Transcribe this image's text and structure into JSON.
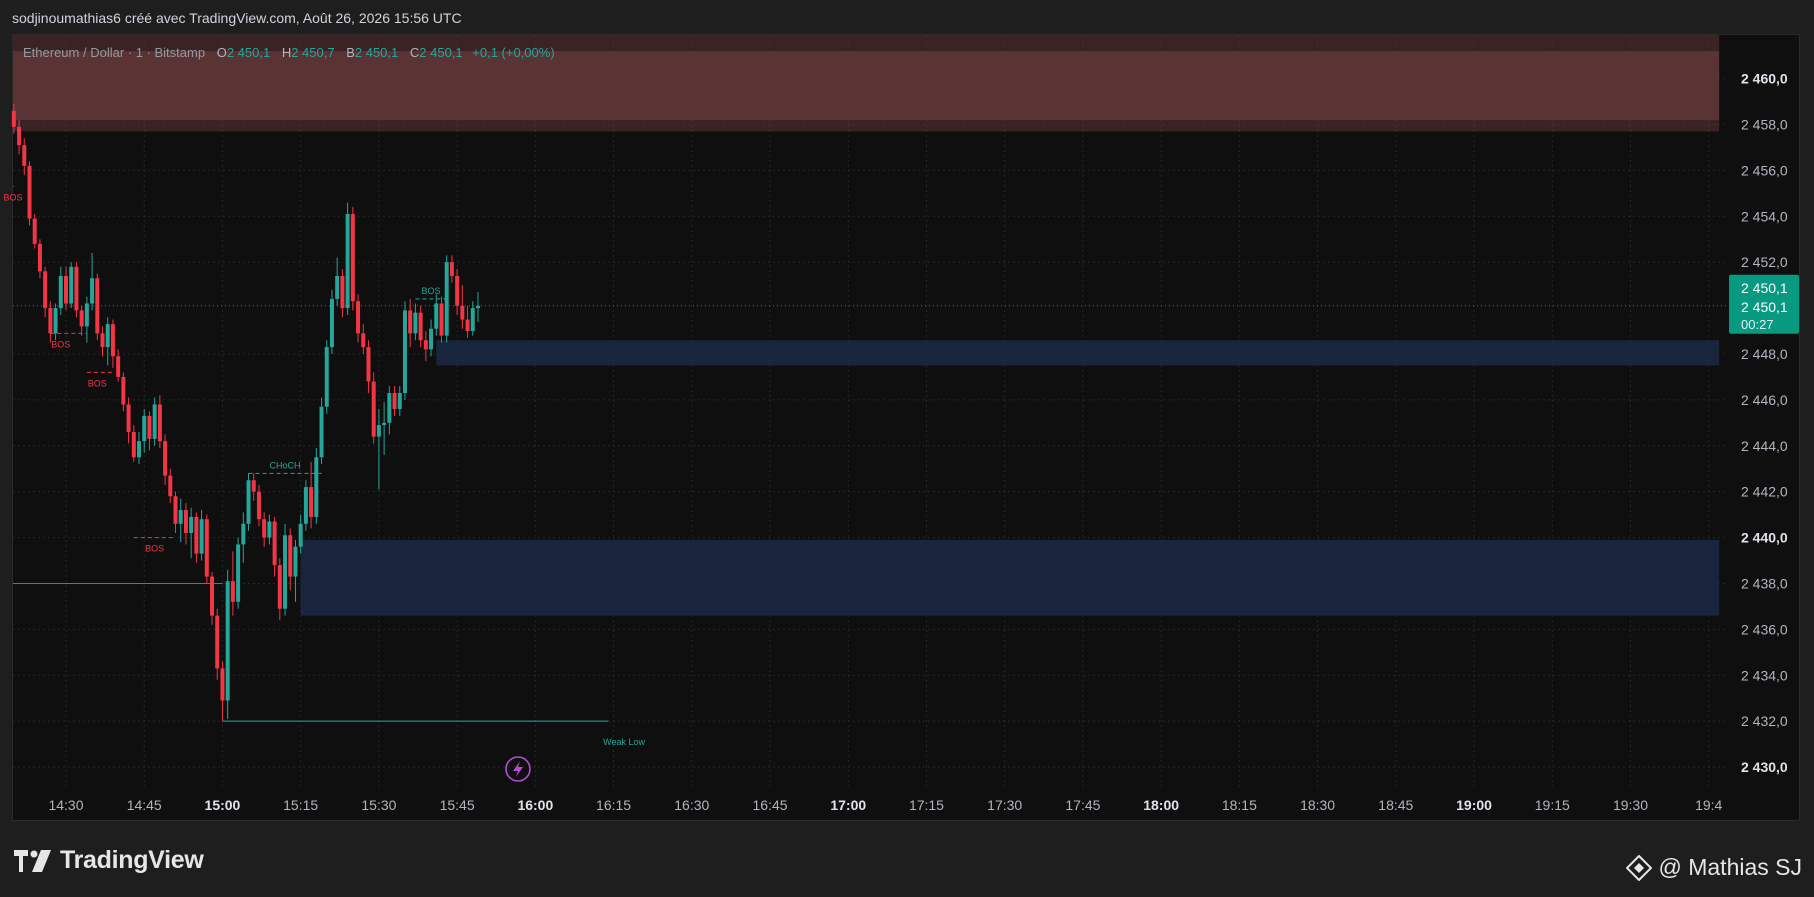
{
  "header": {
    "text": "sodjinoumathias6 créé avec TradingView.com, Août 26, 2026 15:56 UTC"
  },
  "legend": {
    "symbol": "Ethereum / Dollar · 1 · Bitstamp",
    "o_label": "O",
    "o_value": "2 450,1",
    "h_label": "H",
    "h_value": "2 450,7",
    "b_label": "B",
    "b_value": "2 450,1",
    "c_label": "C",
    "c_value": "2 450,1",
    "change": "+0,1 (+0,00%)"
  },
  "price_tag": {
    "price": "2 450,1",
    "price2": "2 450,1",
    "countdown": "00:27",
    "value": 2450.1
  },
  "footer": {
    "brand": "TradingView",
    "credit": "@ Mathias SJ"
  },
  "colors": {
    "up": "#26a69a",
    "down": "#f23645",
    "bg": "#0f0f0f",
    "supply_zone": "#5e3536",
    "demand_zone": "#1a2740",
    "tag": "#089981"
  },
  "chart_data": {
    "type": "candlestick",
    "ylim": [
      2429.0,
      2461.9
    ],
    "y_ticks": [
      {
        "value": 2430.0,
        "label": "2 430,0",
        "bold": true
      },
      {
        "value": 2432.0,
        "label": "2 432,0",
        "bold": false
      },
      {
        "value": 2434.0,
        "label": "2 434,0",
        "bold": false
      },
      {
        "value": 2436.0,
        "label": "2 436,0",
        "bold": false
      },
      {
        "value": 2438.0,
        "label": "2 438,0",
        "bold": false
      },
      {
        "value": 2440.0,
        "label": "2 440,0",
        "bold": true
      },
      {
        "value": 2442.0,
        "label": "2 442,0",
        "bold": false
      },
      {
        "value": 2444.0,
        "label": "2 444,0",
        "bold": false
      },
      {
        "value": 2446.0,
        "label": "2 446,0",
        "bold": false
      },
      {
        "value": 2448.0,
        "label": "2 448,0",
        "bold": false
      },
      {
        "value": 2452.0,
        "label": "2 452,0",
        "bold": false
      },
      {
        "value": 2454.0,
        "label": "2 454,0",
        "bold": false
      },
      {
        "value": 2456.0,
        "label": "2 456,0",
        "bold": false
      },
      {
        "value": 2458.0,
        "label": "2 458,0",
        "bold": false
      },
      {
        "value": 2460.0,
        "label": "2 460,0",
        "bold": true
      }
    ],
    "x_ticks": [
      {
        "label": "14:30",
        "t": 0,
        "bold": false
      },
      {
        "label": "14:45",
        "t": 15,
        "bold": false
      },
      {
        "label": "15:00",
        "t": 30,
        "bold": true
      },
      {
        "label": "15:15",
        "t": 45,
        "bold": false
      },
      {
        "label": "15:30",
        "t": 60,
        "bold": false
      },
      {
        "label": "15:45",
        "t": 75,
        "bold": false
      },
      {
        "label": "16:00",
        "t": 90,
        "bold": true
      },
      {
        "label": "16:15",
        "t": 105,
        "bold": false
      },
      {
        "label": "16:30",
        "t": 120,
        "bold": false
      },
      {
        "label": "16:45",
        "t": 135,
        "bold": false
      },
      {
        "label": "17:00",
        "t": 150,
        "bold": true
      },
      {
        "label": "17:15",
        "t": 165,
        "bold": false
      },
      {
        "label": "17:30",
        "t": 180,
        "bold": false
      },
      {
        "label": "17:45",
        "t": 195,
        "bold": false
      },
      {
        "label": "18:00",
        "t": 210,
        "bold": true
      },
      {
        "label": "18:15",
        "t": 225,
        "bold": false
      },
      {
        "label": "18:30",
        "t": 240,
        "bold": false
      },
      {
        "label": "18:45",
        "t": 255,
        "bold": false
      },
      {
        "label": "19:00",
        "t": 270,
        "bold": true
      },
      {
        "label": "19:15",
        "t": 285,
        "bold": false
      },
      {
        "label": "19:30",
        "t": 300,
        "bold": false
      },
      {
        "label": "19:4",
        "t": 315,
        "bold": false
      }
    ],
    "candles": [
      {
        "t": -10,
        "o": 2458.6,
        "h": 2458.9,
        "l": 2457.6,
        "c": 2457.9
      },
      {
        "t": -9,
        "o": 2457.9,
        "h": 2458.2,
        "l": 2456.7,
        "c": 2457.1
      },
      {
        "t": -8,
        "o": 2457.1,
        "h": 2457.4,
        "l": 2455.8,
        "c": 2456.2
      },
      {
        "t": -7,
        "o": 2456.2,
        "h": 2456.4,
        "l": 2453.6,
        "c": 2453.9
      },
      {
        "t": -6,
        "o": 2453.9,
        "h": 2454.1,
        "l": 2452.6,
        "c": 2452.8
      },
      {
        "t": -5,
        "o": 2452.8,
        "h": 2453.0,
        "l": 2451.3,
        "c": 2451.6
      },
      {
        "t": -4,
        "o": 2451.6,
        "h": 2451.8,
        "l": 2449.6,
        "c": 2450.0
      },
      {
        "t": -3,
        "o": 2450.0,
        "h": 2450.3,
        "l": 2448.5,
        "c": 2448.9
      },
      {
        "t": -2,
        "o": 2448.9,
        "h": 2450.2,
        "l": 2448.6,
        "c": 2450.0
      },
      {
        "t": -1,
        "o": 2450.0,
        "h": 2451.8,
        "l": 2449.7,
        "c": 2451.4
      },
      {
        "t": 0,
        "o": 2451.4,
        "h": 2451.8,
        "l": 2449.9,
        "c": 2450.2
      },
      {
        "t": 1,
        "o": 2450.2,
        "h": 2452.0,
        "l": 2450.0,
        "c": 2451.8
      },
      {
        "t": 2,
        "o": 2451.8,
        "h": 2452.0,
        "l": 2449.6,
        "c": 2449.9
      },
      {
        "t": 3,
        "o": 2449.9,
        "h": 2450.1,
        "l": 2448.8,
        "c": 2449.2
      },
      {
        "t": 4,
        "o": 2449.2,
        "h": 2450.5,
        "l": 2448.5,
        "c": 2450.2
      },
      {
        "t": 5,
        "o": 2450.2,
        "h": 2452.4,
        "l": 2449.9,
        "c": 2451.3
      },
      {
        "t": 6,
        "o": 2451.3,
        "h": 2451.5,
        "l": 2448.6,
        "c": 2448.9
      },
      {
        "t": 7,
        "o": 2448.9,
        "h": 2449.2,
        "l": 2447.9,
        "c": 2448.3
      },
      {
        "t": 8,
        "o": 2448.3,
        "h": 2449.6,
        "l": 2447.5,
        "c": 2449.3
      },
      {
        "t": 9,
        "o": 2449.3,
        "h": 2449.5,
        "l": 2447.4,
        "c": 2447.9
      },
      {
        "t": 10,
        "o": 2447.9,
        "h": 2448.2,
        "l": 2446.8,
        "c": 2447.0
      },
      {
        "t": 11,
        "o": 2447.0,
        "h": 2447.2,
        "l": 2445.5,
        "c": 2445.8
      },
      {
        "t": 12,
        "o": 2445.8,
        "h": 2446.1,
        "l": 2444.1,
        "c": 2444.6
      },
      {
        "t": 13,
        "o": 2444.6,
        "h": 2444.9,
        "l": 2443.3,
        "c": 2443.5
      },
      {
        "t": 14,
        "o": 2443.5,
        "h": 2444.6,
        "l": 2443.2,
        "c": 2444.2
      },
      {
        "t": 15,
        "o": 2444.2,
        "h": 2445.6,
        "l": 2443.7,
        "c": 2445.3
      },
      {
        "t": 16,
        "o": 2445.3,
        "h": 2445.5,
        "l": 2443.8,
        "c": 2444.3
      },
      {
        "t": 17,
        "o": 2444.3,
        "h": 2446.1,
        "l": 2444.0,
        "c": 2445.8
      },
      {
        "t": 18,
        "o": 2445.8,
        "h": 2446.2,
        "l": 2443.9,
        "c": 2444.2
      },
      {
        "t": 19,
        "o": 2444.2,
        "h": 2444.5,
        "l": 2442.3,
        "c": 2442.7
      },
      {
        "t": 20,
        "o": 2442.7,
        "h": 2443.0,
        "l": 2441.5,
        "c": 2441.8
      },
      {
        "t": 21,
        "o": 2441.8,
        "h": 2442.0,
        "l": 2440.2,
        "c": 2440.6
      },
      {
        "t": 22,
        "o": 2440.6,
        "h": 2441.7,
        "l": 2439.8,
        "c": 2441.2
      },
      {
        "t": 23,
        "o": 2441.2,
        "h": 2441.5,
        "l": 2439.7,
        "c": 2440.2
      },
      {
        "t": 24,
        "o": 2440.2,
        "h": 2441.3,
        "l": 2439.1,
        "c": 2440.9
      },
      {
        "t": 25,
        "o": 2440.9,
        "h": 2441.1,
        "l": 2438.9,
        "c": 2439.3
      },
      {
        "t": 26,
        "o": 2439.3,
        "h": 2441.2,
        "l": 2439.0,
        "c": 2440.8
      },
      {
        "t": 27,
        "o": 2440.8,
        "h": 2441.0,
        "l": 2438.0,
        "c": 2438.3
      },
      {
        "t": 28,
        "o": 2438.3,
        "h": 2438.5,
        "l": 2436.2,
        "c": 2436.6
      },
      {
        "t": 29,
        "o": 2436.6,
        "h": 2436.9,
        "l": 2433.8,
        "c": 2434.3
      },
      {
        "t": 30,
        "o": 2434.3,
        "h": 2434.6,
        "l": 2432.0,
        "c": 2432.9
      },
      {
        "t": 31,
        "o": 2432.9,
        "h": 2438.6,
        "l": 2432.1,
        "c": 2438.1
      },
      {
        "t": 32,
        "o": 2438.1,
        "h": 2439.4,
        "l": 2436.6,
        "c": 2437.2
      },
      {
        "t": 33,
        "o": 2437.2,
        "h": 2440.0,
        "l": 2436.9,
        "c": 2439.7
      },
      {
        "t": 34,
        "o": 2439.7,
        "h": 2441.1,
        "l": 2438.9,
        "c": 2440.6
      },
      {
        "t": 35,
        "o": 2440.6,
        "h": 2442.8,
        "l": 2440.3,
        "c": 2442.5
      },
      {
        "t": 36,
        "o": 2442.5,
        "h": 2442.8,
        "l": 2441.6,
        "c": 2442.0
      },
      {
        "t": 37,
        "o": 2442.0,
        "h": 2442.3,
        "l": 2440.5,
        "c": 2440.8
      },
      {
        "t": 38,
        "o": 2440.8,
        "h": 2441.1,
        "l": 2439.6,
        "c": 2440.0
      },
      {
        "t": 39,
        "o": 2440.0,
        "h": 2441.0,
        "l": 2439.7,
        "c": 2440.7
      },
      {
        "t": 40,
        "o": 2440.7,
        "h": 2440.9,
        "l": 2438.3,
        "c": 2438.8
      },
      {
        "t": 41,
        "o": 2438.8,
        "h": 2439.1,
        "l": 2436.4,
        "c": 2436.9
      },
      {
        "t": 42,
        "o": 2436.9,
        "h": 2440.6,
        "l": 2436.6,
        "c": 2440.1
      },
      {
        "t": 43,
        "o": 2440.1,
        "h": 2440.4,
        "l": 2437.7,
        "c": 2438.3
      },
      {
        "t": 44,
        "o": 2438.3,
        "h": 2439.9,
        "l": 2437.2,
        "c": 2439.6
      },
      {
        "t": 45,
        "o": 2439.6,
        "h": 2441.0,
        "l": 2439.3,
        "c": 2440.6
      },
      {
        "t": 46,
        "o": 2440.6,
        "h": 2442.5,
        "l": 2440.3,
        "c": 2442.2
      },
      {
        "t": 47,
        "o": 2442.2,
        "h": 2443.3,
        "l": 2440.4,
        "c": 2440.9
      },
      {
        "t": 48,
        "o": 2440.9,
        "h": 2443.9,
        "l": 2440.6,
        "c": 2443.5
      },
      {
        "t": 49,
        "o": 2443.5,
        "h": 2446.1,
        "l": 2443.2,
        "c": 2445.7
      },
      {
        "t": 50,
        "o": 2445.7,
        "h": 2448.6,
        "l": 2445.4,
        "c": 2448.3
      },
      {
        "t": 51,
        "o": 2448.3,
        "h": 2450.8,
        "l": 2448.0,
        "c": 2450.4
      },
      {
        "t": 52,
        "o": 2450.4,
        "h": 2452.2,
        "l": 2450.1,
        "c": 2451.4
      },
      {
        "t": 53,
        "o": 2451.4,
        "h": 2451.7,
        "l": 2449.6,
        "c": 2450.0
      },
      {
        "t": 54,
        "o": 2450.0,
        "h": 2454.6,
        "l": 2449.7,
        "c": 2454.1
      },
      {
        "t": 55,
        "o": 2454.1,
        "h": 2454.4,
        "l": 2449.9,
        "c": 2450.3
      },
      {
        "t": 56,
        "o": 2450.3,
        "h": 2450.6,
        "l": 2448.5,
        "c": 2448.9
      },
      {
        "t": 57,
        "o": 2448.9,
        "h": 2449.3,
        "l": 2448.0,
        "c": 2448.3
      },
      {
        "t": 58,
        "o": 2448.3,
        "h": 2448.6,
        "l": 2446.3,
        "c": 2446.8
      },
      {
        "t": 59,
        "o": 2446.8,
        "h": 2447.2,
        "l": 2444.1,
        "c": 2444.4
      },
      {
        "t": 60,
        "o": 2444.4,
        "h": 2445.6,
        "l": 2442.1,
        "c": 2444.9
      },
      {
        "t": 61,
        "o": 2444.9,
        "h": 2445.9,
        "l": 2443.6,
        "c": 2445.0
      },
      {
        "t": 62,
        "o": 2445.0,
        "h": 2446.6,
        "l": 2444.5,
        "c": 2446.3
      },
      {
        "t": 63,
        "o": 2446.3,
        "h": 2446.6,
        "l": 2445.3,
        "c": 2445.6
      },
      {
        "t": 64,
        "o": 2445.6,
        "h": 2446.6,
        "l": 2445.3,
        "c": 2446.3
      },
      {
        "t": 65,
        "o": 2446.3,
        "h": 2450.3,
        "l": 2446.0,
        "c": 2449.9
      },
      {
        "t": 66,
        "o": 2449.9,
        "h": 2450.4,
        "l": 2448.3,
        "c": 2448.9
      },
      {
        "t": 67,
        "o": 2448.9,
        "h": 2450.2,
        "l": 2448.6,
        "c": 2449.8
      },
      {
        "t": 68,
        "o": 2449.8,
        "h": 2450.1,
        "l": 2448.3,
        "c": 2448.6
      },
      {
        "t": 69,
        "o": 2448.6,
        "h": 2449.0,
        "l": 2447.7,
        "c": 2448.2
      },
      {
        "t": 70,
        "o": 2448.2,
        "h": 2449.5,
        "l": 2447.9,
        "c": 2449.1
      },
      {
        "t": 71,
        "o": 2449.1,
        "h": 2450.6,
        "l": 2448.8,
        "c": 2450.2
      },
      {
        "t": 72,
        "o": 2450.2,
        "h": 2450.5,
        "l": 2448.5,
        "c": 2448.8
      },
      {
        "t": 73,
        "o": 2448.8,
        "h": 2452.3,
        "l": 2448.5,
        "c": 2452.0
      },
      {
        "t": 74,
        "o": 2452.0,
        "h": 2452.3,
        "l": 2451.1,
        "c": 2451.4
      },
      {
        "t": 75,
        "o": 2451.4,
        "h": 2451.7,
        "l": 2449.7,
        "c": 2450.1
      },
      {
        "t": 76,
        "o": 2450.1,
        "h": 2451.0,
        "l": 2449.1,
        "c": 2449.5
      },
      {
        "t": 77,
        "o": 2449.5,
        "h": 2450.1,
        "l": 2448.7,
        "c": 2449.0
      },
      {
        "t": 78,
        "o": 2449.0,
        "h": 2450.3,
        "l": 2448.8,
        "c": 2450.0
      },
      {
        "t": 79,
        "o": 2450.0,
        "h": 2450.7,
        "l": 2449.4,
        "c": 2450.1
      }
    ],
    "zones": [
      {
        "name": "supply-zone",
        "from_t": -13,
        "to_t": 317,
        "top": 2461.9,
        "bottom": 2457.7,
        "inner_top": 2461.2,
        "inner_bottom": 2458.2
      },
      {
        "name": "demand-zone-upper",
        "from_t": 71,
        "to_t": 317,
        "top": 2448.6,
        "bottom": 2447.5
      },
      {
        "name": "demand-zone-lower",
        "from_t": 45,
        "to_t": 317,
        "top": 2439.9,
        "bottom": 2436.6
      }
    ],
    "levels": [
      {
        "type": "bos",
        "label": "BOS",
        "from_t": -13,
        "to_t": -10,
        "price": 2455.3,
        "color": "#f23645",
        "label_t": -13,
        "label_side": "below"
      },
      {
        "type": "bos",
        "label": "BOS",
        "from_t": -3,
        "to_t": 4,
        "price": 2448.9,
        "color": "#f23645",
        "label_t": -1,
        "label_side": "below"
      },
      {
        "type": "bos",
        "label": "BOS",
        "from_t": 4,
        "to_t": 9,
        "price": 2447.2,
        "color": "#f23645",
        "label_t": 6,
        "label_side": "below"
      },
      {
        "type": "bos",
        "label": "BOS",
        "from_t": 13,
        "to_t": 21,
        "price": 2440.0,
        "color": "#f23645",
        "label_t": 17,
        "label_side": "below"
      },
      {
        "type": "choch",
        "label": "CHoCH",
        "from_t": 35,
        "to_t": 49,
        "price": 2442.8,
        "color": "#26a69a",
        "label_t": 42,
        "label_side": "above"
      },
      {
        "type": "bos",
        "label": "BOS",
        "from_t": 67,
        "to_t": 73,
        "price": 2450.4,
        "color": "#26a69a",
        "label_t": 70,
        "label_side": "above"
      }
    ],
    "lines": [
      {
        "name": "strong-high-line",
        "from_t": -13,
        "to_t": 30,
        "price": 2438.0,
        "color": "#f23645"
      },
      {
        "name": "weak-low-line",
        "from_t": 30,
        "to_t": 104,
        "price": 2432.0,
        "color": "#26a69a"
      }
    ],
    "annotations": [
      {
        "label": "Weak Low",
        "t": 103,
        "price": 2431.4,
        "color": "#26a69a"
      }
    ],
    "last_price_line": 2450.1
  }
}
